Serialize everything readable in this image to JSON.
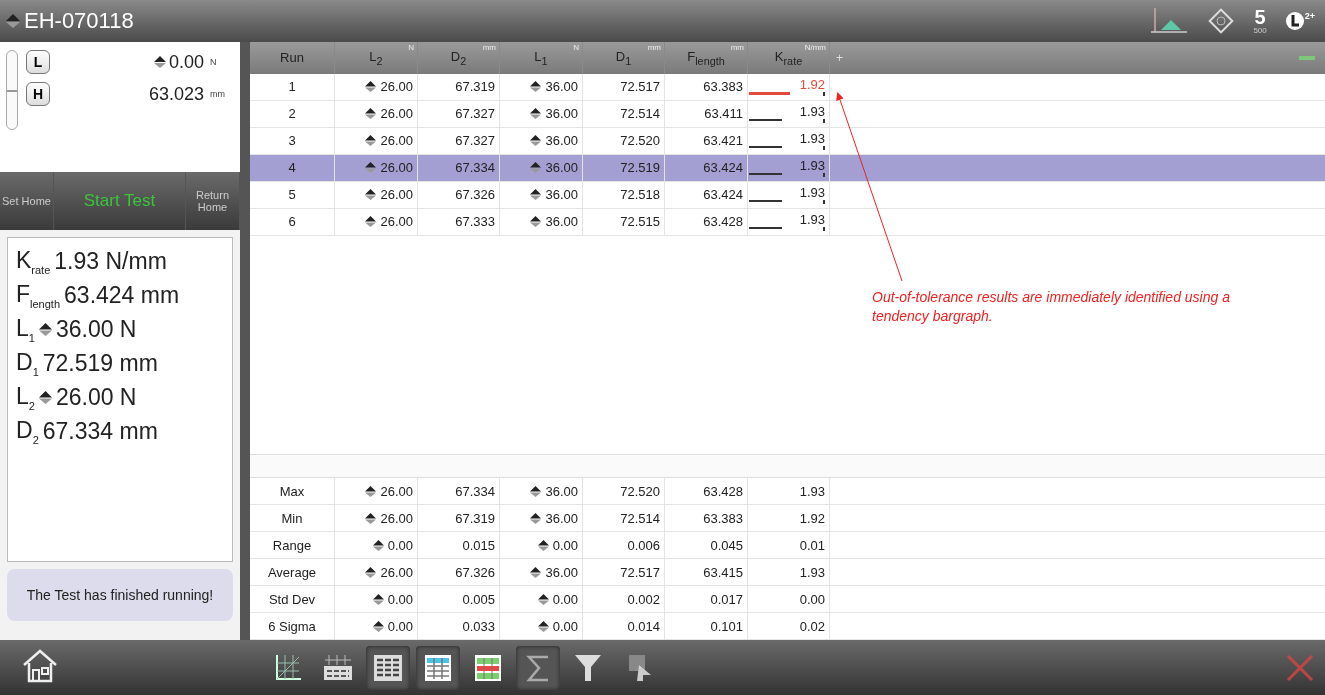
{
  "title": {
    "text": "EH-070118"
  },
  "header_icons": [
    {
      "kind": "chart"
    },
    {
      "kind": "diamond"
    },
    {
      "kind": "counter",
      "text": "5",
      "caption": "500"
    },
    {
      "kind": "clock",
      "badge": "2+"
    }
  ],
  "jog": {
    "slider": {
      "level": 0.5
    },
    "readouts": [
      {
        "button": "L",
        "value": "0.00",
        "unit": "N",
        "spinner": true
      },
      {
        "button": "H",
        "value": "63.023",
        "unit": "mm",
        "spinner": false
      }
    ]
  },
  "actions": [
    {
      "label": "Set Home",
      "kind": "plain"
    },
    {
      "label": "Start Test",
      "kind": "primary"
    },
    {
      "label": "Return Home",
      "kind": "plain"
    }
  ],
  "summary": [
    {
      "label": "K$_{rate}$",
      "value": "1.93 N/mm",
      "spinner": false
    },
    {
      "label": "F$_{length}$",
      "value": "63.424 mm",
      "spinner": false
    },
    {
      "label": "L$_{1}$",
      "value": "36.00 N",
      "spinner": true
    },
    {
      "label": "D$_{1}$",
      "value": "72.519 mm",
      "spinner": false
    },
    {
      "label": "L$_{2}$",
      "value": "26.00 N",
      "spinner": true
    },
    {
      "label": "D$_{2}$",
      "value": "67.334 mm",
      "spinner": false
    }
  ],
  "status_message": "The Test has finished running!",
  "table": {
    "columns": [
      {
        "label": "Run",
        "kind": "run"
      },
      {
        "label": "L$_{2}$",
        "unit": "N",
        "kind": "force"
      },
      {
        "label": "D$_{2}$",
        "unit": "mm",
        "kind": "length"
      },
      {
        "label": "L$_{1}$",
        "unit": "N",
        "kind": "force"
      },
      {
        "label": "D$_{1}$",
        "unit": "mm",
        "kind": "length"
      },
      {
        "label": "F$_{length}$",
        "unit": "mm",
        "kind": "length"
      },
      {
        "label": "K$_{rate}$",
        "unit": "N/mm",
        "kind": "rate"
      }
    ],
    "add_column": "+",
    "rows": [
      {
        "selected": false,
        "cells": [
          "1",
          "26.00",
          "67.319",
          "36.00",
          "72.517",
          "63.383",
          "1.92"
        ],
        "tendency": {
          "level": 0.55,
          "alert": true
        }
      },
      {
        "selected": false,
        "cells": [
          "2",
          "26.00",
          "67.327",
          "36.00",
          "72.514",
          "63.411",
          "1.93"
        ],
        "tendency": {
          "level": 0.45,
          "alert": false
        }
      },
      {
        "selected": false,
        "cells": [
          "3",
          "26.00",
          "67.327",
          "36.00",
          "72.520",
          "63.421",
          "1.93"
        ],
        "tendency": {
          "level": 0.45,
          "alert": false
        }
      },
      {
        "selected": true,
        "cells": [
          "4",
          "26.00",
          "67.334",
          "36.00",
          "72.519",
          "63.424",
          "1.93"
        ],
        "tendency": {
          "level": 0.45,
          "alert": false
        }
      },
      {
        "selected": false,
        "cells": [
          "5",
          "26.00",
          "67.326",
          "36.00",
          "72.518",
          "63.424",
          "1.93"
        ],
        "tendency": {
          "level": 0.45,
          "alert": false
        }
      },
      {
        "selected": false,
        "cells": [
          "6",
          "26.00",
          "67.333",
          "36.00",
          "72.515",
          "63.428",
          "1.93"
        ],
        "tendency": {
          "level": 0.45,
          "alert": false
        }
      }
    ],
    "stats": [
      {
        "cells": [
          "Max",
          "26.00",
          "67.334",
          "36.00",
          "72.520",
          "63.428",
          "1.93"
        ]
      },
      {
        "cells": [
          "Min",
          "26.00",
          "67.319",
          "36.00",
          "72.514",
          "63.383",
          "1.92"
        ]
      },
      {
        "cells": [
          "Range",
          "0.00",
          "0.015",
          "0.00",
          "0.006",
          "0.045",
          "0.01"
        ]
      },
      {
        "cells": [
          "Average",
          "26.00",
          "67.326",
          "36.00",
          "72.517",
          "63.415",
          "1.93"
        ]
      },
      {
        "cells": [
          "Std Dev",
          "0.00",
          "0.005",
          "0.00",
          "0.002",
          "0.017",
          "0.00"
        ]
      },
      {
        "cells": [
          "6 Sigma",
          "0.00",
          "0.033",
          "0.00",
          "0.014",
          "0.101",
          "0.02"
        ]
      }
    ]
  },
  "annotation": {
    "text": "Out-of-tolerance results are immediately identified using a tendency bargraph."
  },
  "toolbar": [
    {
      "kind": "chart-grid",
      "selected": false
    },
    {
      "kind": "table-chart",
      "selected": false
    },
    {
      "kind": "table",
      "selected": true
    },
    {
      "kind": "color-table",
      "selected": true
    },
    {
      "kind": "tolerance-table",
      "selected": false
    },
    {
      "kind": "sigma",
      "selected": true
    },
    {
      "kind": "filter",
      "selected": false
    },
    {
      "kind": "export",
      "selected": false
    }
  ]
}
